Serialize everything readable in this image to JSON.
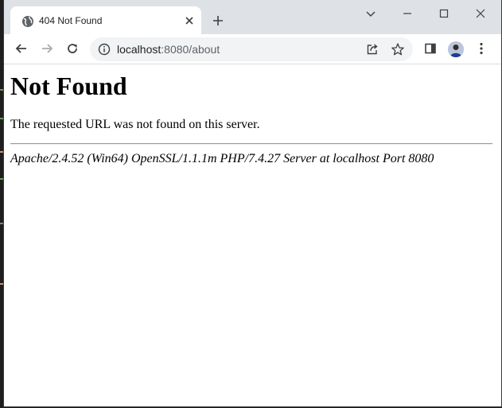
{
  "tab": {
    "title": "404 Not Found",
    "favicon": "globe-icon"
  },
  "address_bar": {
    "url_host": "localhost",
    "url_rest": ":8080/about"
  },
  "page": {
    "heading": "Not Found",
    "message": "The requested URL was not found on this server.",
    "address": "Apache/2.4.52 (Win64) OpenSSL/1.1.1m PHP/7.4.27 Server at localhost Port 8080"
  },
  "icons": {
    "tab_close": "close-icon",
    "new_tab": "plus-icon",
    "tab_search": "chevron-down-icon",
    "minimize": "minimize-icon",
    "maximize": "maximize-icon",
    "close": "close-window-icon",
    "back": "back-arrow-icon",
    "forward": "forward-arrow-icon",
    "reload": "reload-icon",
    "site_info": "info-icon",
    "share": "share-icon",
    "bookmark": "star-icon",
    "side_panel": "side-panel-icon",
    "profile": "avatar",
    "menu": "kebab-menu-icon"
  },
  "colors": {
    "tabstrip": "#dee1e6",
    "omnibox": "#f1f3f4",
    "icon": "#5f6368",
    "background_editor": "#1e1e1e"
  }
}
